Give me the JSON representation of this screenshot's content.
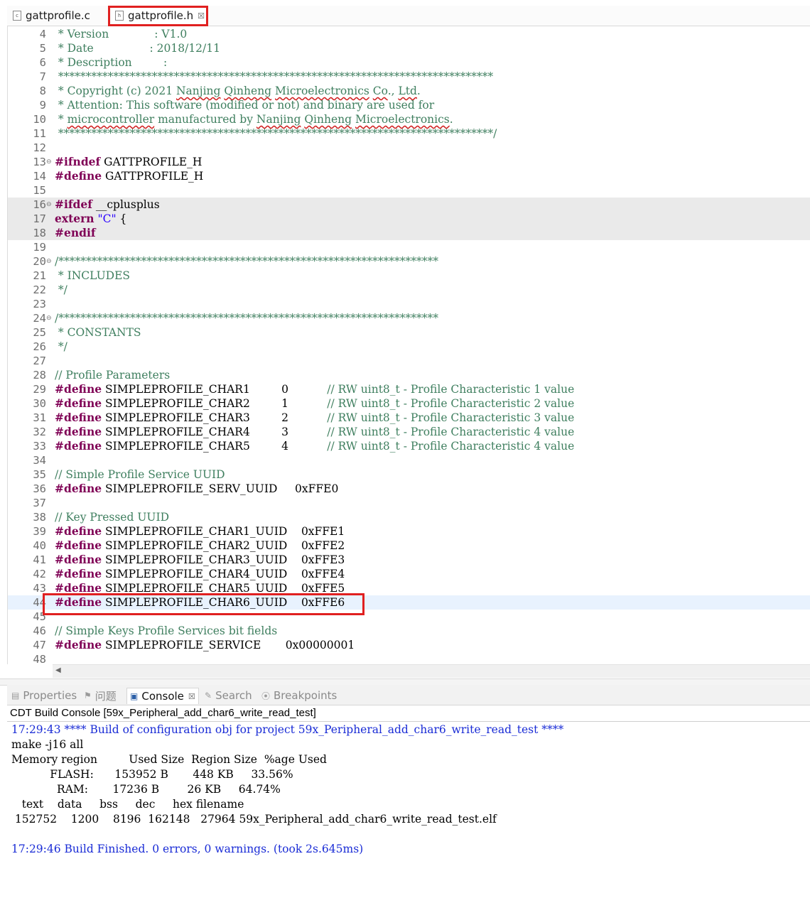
{
  "tabs": [
    {
      "label": "gattprofile.c",
      "icon": "c-file-icon",
      "active": false
    },
    {
      "label": "gattprofile.h",
      "icon": "h-file-icon",
      "active": true,
      "close": "☒"
    }
  ],
  "editor_lines": [
    {
      "n": "4",
      "segs": [
        {
          "c": "cm",
          "t": " * Version             : V1.0"
        }
      ]
    },
    {
      "n": "5",
      "segs": [
        {
          "c": "cm",
          "t": " * Date                : 2018/12/11"
        }
      ]
    },
    {
      "n": "6",
      "segs": [
        {
          "c": "cm",
          "t": " * Description         :"
        }
      ]
    },
    {
      "n": "7",
      "segs": [
        {
          "c": "cm",
          "t": " *******************************************************************************"
        }
      ]
    },
    {
      "n": "8",
      "segs": [
        {
          "c": "cm",
          "t": " * Copyright (c) 2021 "
        },
        {
          "c": "cm sq",
          "t": "Nanjing"
        },
        {
          "c": "cm",
          "t": " "
        },
        {
          "c": "cm sq",
          "t": "Qinheng"
        },
        {
          "c": "cm",
          "t": " "
        },
        {
          "c": "cm sq",
          "t": "Microelectronics"
        },
        {
          "c": "cm",
          "t": " "
        },
        {
          "c": "cm sq",
          "t": "Co"
        },
        {
          "c": "cm",
          "t": "., "
        },
        {
          "c": "cm sq",
          "t": "Ltd"
        },
        {
          "c": "cm",
          "t": "."
        }
      ]
    },
    {
      "n": "9",
      "segs": [
        {
          "c": "cm",
          "t": " * Attention: This software (modified or not) and binary are used for"
        }
      ]
    },
    {
      "n": "10",
      "segs": [
        {
          "c": "cm",
          "t": " * "
        },
        {
          "c": "cm sq",
          "t": "microcontroller"
        },
        {
          "c": "cm",
          "t": " manufactured by "
        },
        {
          "c": "cm sq",
          "t": "Nanjing"
        },
        {
          "c": "cm",
          "t": " "
        },
        {
          "c": "cm sq",
          "t": "Qinheng"
        },
        {
          "c": "cm",
          "t": " "
        },
        {
          "c": "cm sq",
          "t": "Microelectronics"
        },
        {
          "c": "cm",
          "t": "."
        }
      ]
    },
    {
      "n": "11",
      "segs": [
        {
          "c": "cm",
          "t": " *******************************************************************************/"
        }
      ]
    },
    {
      "n": "12",
      "segs": []
    },
    {
      "n": "13",
      "fold": true,
      "segs": [
        {
          "c": "kw",
          "t": "#ifndef"
        },
        {
          "c": "",
          "t": " GATTPROFILE_H"
        }
      ]
    },
    {
      "n": "14",
      "segs": [
        {
          "c": "kw",
          "t": "#define"
        },
        {
          "c": "",
          "t": " GATTPROFILE_H"
        }
      ]
    },
    {
      "n": "15",
      "segs": []
    },
    {
      "n": "16",
      "fold": true,
      "shaded": true,
      "segs": [
        {
          "c": "kw",
          "t": "#ifdef"
        },
        {
          "c": "",
          "t": " __cplusplus"
        }
      ]
    },
    {
      "n": "17",
      "shaded": true,
      "segs": [
        {
          "c": "kw",
          "t": "extern"
        },
        {
          "c": "",
          "t": " "
        },
        {
          "c": "str",
          "t": "\"C\""
        },
        {
          "c": "",
          "t": " {"
        }
      ]
    },
    {
      "n": "18",
      "shaded": true,
      "segs": [
        {
          "c": "kw",
          "t": "#endif"
        }
      ]
    },
    {
      "n": "19",
      "segs": []
    },
    {
      "n": "20",
      "fold": true,
      "segs": [
        {
          "c": "cm",
          "t": "/*********************************************************************"
        }
      ]
    },
    {
      "n": "21",
      "segs": [
        {
          "c": "cm",
          "t": " * INCLUDES"
        }
      ]
    },
    {
      "n": "22",
      "segs": [
        {
          "c": "cm",
          "t": " */"
        }
      ]
    },
    {
      "n": "23",
      "segs": []
    },
    {
      "n": "24",
      "fold": true,
      "segs": [
        {
          "c": "cm",
          "t": "/*********************************************************************"
        }
      ]
    },
    {
      "n": "25",
      "segs": [
        {
          "c": "cm",
          "t": " * CONSTANTS"
        }
      ]
    },
    {
      "n": "26",
      "segs": [
        {
          "c": "cm",
          "t": " */"
        }
      ]
    },
    {
      "n": "27",
      "segs": []
    },
    {
      "n": "28",
      "segs": [
        {
          "c": "cm",
          "t": "// Profile Parameters"
        }
      ]
    },
    {
      "n": "29",
      "segs": [
        {
          "c": "kw",
          "t": "#define"
        },
        {
          "c": "",
          "t": " SIMPLEPROFILE_CHAR1         0           "
        },
        {
          "c": "cm",
          "t": "// RW uint8_t - Profile Characteristic 1 value"
        }
      ]
    },
    {
      "n": "30",
      "segs": [
        {
          "c": "kw",
          "t": "#define"
        },
        {
          "c": "",
          "t": " SIMPLEPROFILE_CHAR2         1           "
        },
        {
          "c": "cm",
          "t": "// RW uint8_t - Profile Characteristic 2 value"
        }
      ]
    },
    {
      "n": "31",
      "segs": [
        {
          "c": "kw",
          "t": "#define"
        },
        {
          "c": "",
          "t": " SIMPLEPROFILE_CHAR3         2           "
        },
        {
          "c": "cm",
          "t": "// RW uint8_t - Profile Characteristic 3 value"
        }
      ]
    },
    {
      "n": "32",
      "segs": [
        {
          "c": "kw",
          "t": "#define"
        },
        {
          "c": "",
          "t": " SIMPLEPROFILE_CHAR4         3           "
        },
        {
          "c": "cm",
          "t": "// RW uint8_t - Profile Characteristic 4 value"
        }
      ]
    },
    {
      "n": "33",
      "segs": [
        {
          "c": "kw",
          "t": "#define"
        },
        {
          "c": "",
          "t": " SIMPLEPROFILE_CHAR5         4           "
        },
        {
          "c": "cm",
          "t": "// RW uint8_t - Profile Characteristic 4 value"
        }
      ]
    },
    {
      "n": "34",
      "segs": []
    },
    {
      "n": "35",
      "segs": [
        {
          "c": "cm",
          "t": "// Simple Profile Service UUID"
        }
      ]
    },
    {
      "n": "36",
      "segs": [
        {
          "c": "kw",
          "t": "#define"
        },
        {
          "c": "",
          "t": " SIMPLEPROFILE_SERV_UUID     0xFFE0"
        }
      ]
    },
    {
      "n": "37",
      "segs": []
    },
    {
      "n": "38",
      "segs": [
        {
          "c": "cm",
          "t": "// Key Pressed UUID"
        }
      ]
    },
    {
      "n": "39",
      "segs": [
        {
          "c": "kw",
          "t": "#define"
        },
        {
          "c": "",
          "t": " SIMPLEPROFILE_CHAR1_UUID    0xFFE1"
        }
      ]
    },
    {
      "n": "40",
      "segs": [
        {
          "c": "kw",
          "t": "#define"
        },
        {
          "c": "",
          "t": " SIMPLEPROFILE_CHAR2_UUID    0xFFE2"
        }
      ]
    },
    {
      "n": "41",
      "segs": [
        {
          "c": "kw",
          "t": "#define"
        },
        {
          "c": "",
          "t": " SIMPLEPROFILE_CHAR3_UUID    0xFFE3"
        }
      ]
    },
    {
      "n": "42",
      "segs": [
        {
          "c": "kw",
          "t": "#define"
        },
        {
          "c": "",
          "t": " SIMPLEPROFILE_CHAR4_UUID    0xFFE4"
        }
      ]
    },
    {
      "n": "43",
      "segs": [
        {
          "c": "kw",
          "t": "#define"
        },
        {
          "c": "",
          "t": " SIMPLEPROFILE_CHAR5_UUID    0xFFE5"
        }
      ]
    },
    {
      "n": "44",
      "current": true,
      "segs": [
        {
          "c": "kw",
          "t": "#define"
        },
        {
          "c": "",
          "t": " SIMPLEPROFILE_CHAR6_UUID    0xFFE6"
        }
      ]
    },
    {
      "n": "45",
      "segs": []
    },
    {
      "n": "46",
      "segs": [
        {
          "c": "cm",
          "t": "// Simple Keys Profile Services bit fields"
        }
      ]
    },
    {
      "n": "47",
      "segs": [
        {
          "c": "kw",
          "t": "#define"
        },
        {
          "c": "",
          "t": " SIMPLEPROFILE_SERVICE       0x00000001"
        }
      ]
    },
    {
      "n": "48",
      "segs": []
    }
  ],
  "view_tabs": [
    {
      "label": "Properties",
      "icon": "properties-icon",
      "glyph": "▤",
      "active": false
    },
    {
      "label": "问题",
      "icon": "problems-icon",
      "glyph": "⚑",
      "active": false
    },
    {
      "label": "Console",
      "icon": "console-icon",
      "glyph": "▣",
      "active": true,
      "close": "☒"
    },
    {
      "label": "Search",
      "icon": "search-icon",
      "glyph": "✎",
      "active": false
    },
    {
      "label": "Breakpoints",
      "icon": "breakpoints-icon",
      "glyph": "⦿",
      "active": false
    }
  ],
  "console": {
    "title": "CDT Build Console [59x_Peripheral_add_char6_write_read_test]",
    "lines": [
      {
        "blue": true,
        "t": "17:29:43 **** Build of configuration obj for project 59x_Peripheral_add_char6_write_read_test ****"
      },
      {
        "blue": false,
        "t": "make -j16 all"
      },
      {
        "blue": false,
        "t": "Memory region         Used Size  Region Size  %age Used"
      },
      {
        "blue": false,
        "t": "           FLASH:      153952 B       448 KB     33.56%"
      },
      {
        "blue": false,
        "t": "             RAM:       17236 B        26 KB     64.74%"
      },
      {
        "blue": false,
        "t": "   text    data     bss     dec     hex filename"
      },
      {
        "blue": false,
        "t": " 152752    1200    8196  162148   27964 59x_Peripheral_add_char6_write_read_test.elf"
      },
      {
        "blue": false,
        "t": ""
      },
      {
        "blue": true,
        "t": "17:29:46 Build Finished. 0 errors, 0 warnings. (took 2s.645ms)"
      }
    ]
  },
  "colors": {
    "highlight_box": "#e02020",
    "keyword": "#7f0055",
    "comment": "#3f7f5f",
    "string": "#2a00ff",
    "console_info": "#1a2cd6"
  }
}
